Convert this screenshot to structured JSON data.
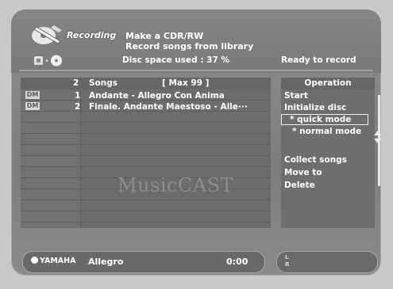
{
  "header": {
    "title": "Recording",
    "message_line1": "Make a CDR/RW",
    "message_line2": "Record songs from library",
    "disc_space": "Disc space used : 37 %",
    "status": "Ready to record"
  },
  "list": {
    "header_count": "2",
    "header_label": "Songs",
    "header_max": "[ Max 99 ]",
    "items": [
      {
        "badge": "DM",
        "number": "1",
        "title": "Andante - Allegro Con Anima"
      },
      {
        "badge": "DM",
        "number": "2",
        "title": "Finale. Andante Maestoso - Alle···"
      }
    ],
    "watermark": "MusicCAST"
  },
  "operation": {
    "header": "Operation",
    "items": [
      {
        "label": "Start"
      },
      {
        "label": "Initialize disc"
      },
      {
        "label": "* quick mode"
      },
      {
        "label": "* normal mode"
      },
      {
        "label": "Collect songs"
      },
      {
        "label": "Move to"
      },
      {
        "label": "Delete"
      }
    ]
  },
  "player": {
    "brand": "YAMAHA",
    "track": "Allegro",
    "time": "0:00"
  },
  "level_meter": {
    "left_label": "L",
    "right_label": "R"
  },
  "colors": {
    "screen_background": "#7e7e7e",
    "panel_background": "#6c6c6c",
    "text": "#ffffff"
  }
}
